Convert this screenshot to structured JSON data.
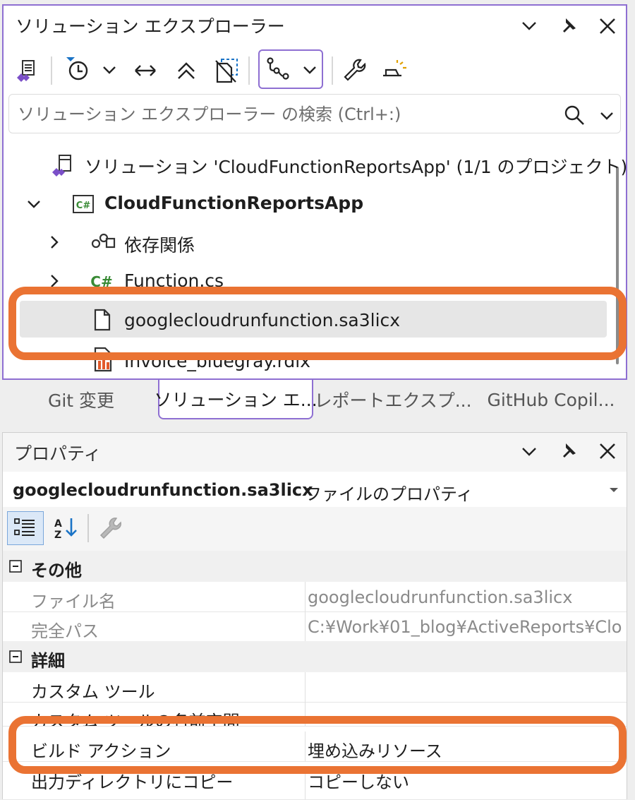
{
  "solution_explorer": {
    "title": "ソリューション エクスプローラー",
    "search_placeholder": "ソリューション エクスプローラー の検索 (Ctrl+:)",
    "tree": {
      "solution": "ソリューション 'CloudFunctionReportsApp' (1/1 のプロジェクト)",
      "project": "CloudFunctionReportsApp",
      "dependencies": "依存関係",
      "function_cs": "Function.cs",
      "sa3licx": "googlecloudrunfunction.sa3licx",
      "rdlx": "Invoice_bluegray.rdlx"
    }
  },
  "tabs": [
    {
      "label": "Git 変更"
    },
    {
      "label": "ソリューション エ..."
    },
    {
      "label": "レポートエクスプ..."
    },
    {
      "label": "GitHub Copil..."
    }
  ],
  "properties": {
    "title": "プロパティ",
    "object_name": "googlecloudrunfunction.sa3licx",
    "object_type": "ファイルのプロパティ",
    "categories": {
      "other": "その他",
      "detail": "詳細"
    },
    "rows": {
      "file_name": {
        "name": "ファイル名",
        "value": "googlecloudrunfunction.sa3licx"
      },
      "full_path": {
        "name": "完全パス",
        "value": "C:¥Work¥01_blog¥ActiveReports¥Clo"
      },
      "custom_tool": {
        "name": "カスタム ツール",
        "value": ""
      },
      "custom_tool_ns": {
        "name": "カスタム ツールの名前空間",
        "value": ""
      },
      "build_action": {
        "name": "ビルド アクション",
        "value": "埋め込みリソース"
      },
      "copy_output": {
        "name": "出力ディレクトリにコピー",
        "value": "コピーしない"
      }
    }
  },
  "colors": {
    "accent_purple": "#8e6fd2",
    "highlight_orange": "#ea7333",
    "csharp_green": "#388a34"
  }
}
